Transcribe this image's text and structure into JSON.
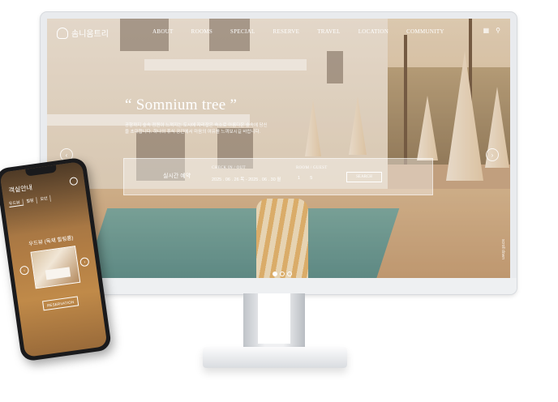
{
  "site": {
    "logo_text": "솜니움트리",
    "nav": [
      "ABOUT",
      "ROOMS",
      "SPECIAL",
      "RESERVE",
      "TRAVEL",
      "LOCATION",
      "COMMUNITY"
    ],
    "hero_title": "“ Somnium tree ”",
    "hero_desc": "공항까지 숲속 정원이 느껴지는 도시에 자리잡은 숙소로 아름다운 숲속에 당신을 초대합니다. 하나의 휴식 공간에서 마음의 여유를 느껴보시길 바랍니다.",
    "booking": {
      "title": "실시간 예약",
      "checkin_label": "CHECK IN / OUT",
      "checkin_value": "2025 . 06 . 26 목 - 2025 . 06 . 30 월",
      "room_label": "ROOM / GUEST",
      "room_value": "1        5",
      "search_label": "SEARCH"
    },
    "side_text": "scroll down",
    "arrow_left": "‹",
    "arrow_right": "›"
  },
  "mobile": {
    "header": "객실안내",
    "tabs": [
      "우드뷰",
      "힐링",
      "모던"
    ],
    "room_name": "우드뷰 (독채 힐링룸)",
    "button_label": "RESERVATION",
    "arrow_left": "‹",
    "arrow_right": "›"
  },
  "colors": {
    "accent": "#ffffff",
    "bezel": "#1a1a1c",
    "monitor_frame": "#e9ebee"
  }
}
